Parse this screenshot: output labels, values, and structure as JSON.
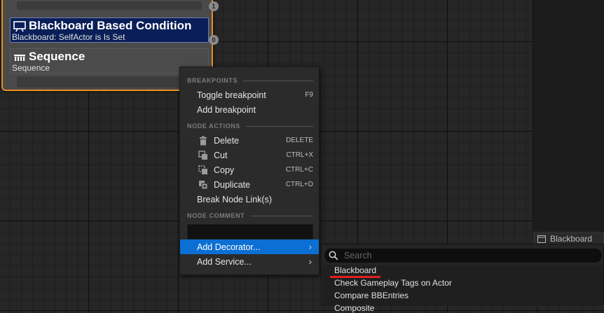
{
  "node": {
    "top_pin_badge": "1",
    "mid_pin_badge": "0",
    "decorator": {
      "title": "Blackboard Based Condition",
      "subtitle": "Blackboard: SelfActor is Is Set",
      "icon": "monitor-icon"
    },
    "composite": {
      "title": "Sequence",
      "subtitle": "Sequence",
      "icon": "sequence-icon"
    }
  },
  "side_tab": {
    "label": "Blackboard",
    "icon": "window-icon"
  },
  "context_menu": {
    "sections": {
      "breakpoints": "BREAKPOINTS",
      "node_actions": "NODE ACTIONS",
      "node_comment": "NODE COMMENT"
    },
    "items": {
      "toggle_breakpoint": {
        "label": "Toggle breakpoint",
        "shortcut": "F9"
      },
      "add_breakpoint": {
        "label": "Add breakpoint"
      },
      "delete": {
        "label": "Delete",
        "shortcut": "DELETE",
        "icon": "trash-icon"
      },
      "cut": {
        "label": "Cut",
        "shortcut": "CTRL+X",
        "icon": "cut-icon"
      },
      "copy": {
        "label": "Copy",
        "shortcut": "CTRL+C",
        "icon": "copy-icon"
      },
      "duplicate": {
        "label": "Duplicate",
        "shortcut": "CTRL+D",
        "icon": "duplicate-icon"
      },
      "break_links": {
        "label": "Break Node Link(s)"
      },
      "add_decorator": {
        "label": "Add Decorator..."
      },
      "add_service": {
        "label": "Add Service..."
      }
    },
    "comment_value": ""
  },
  "submenu": {
    "search_placeholder": "Search",
    "items": [
      "Blackboard",
      "Check Gameplay Tags on Actor",
      "Compare BBEntries",
      "Composite"
    ]
  },
  "colors": {
    "node_border": "#e8901a",
    "decorator_bg": "#0a1f58",
    "highlight": "#0b6fd4",
    "annotation_underline": "#e02020"
  }
}
